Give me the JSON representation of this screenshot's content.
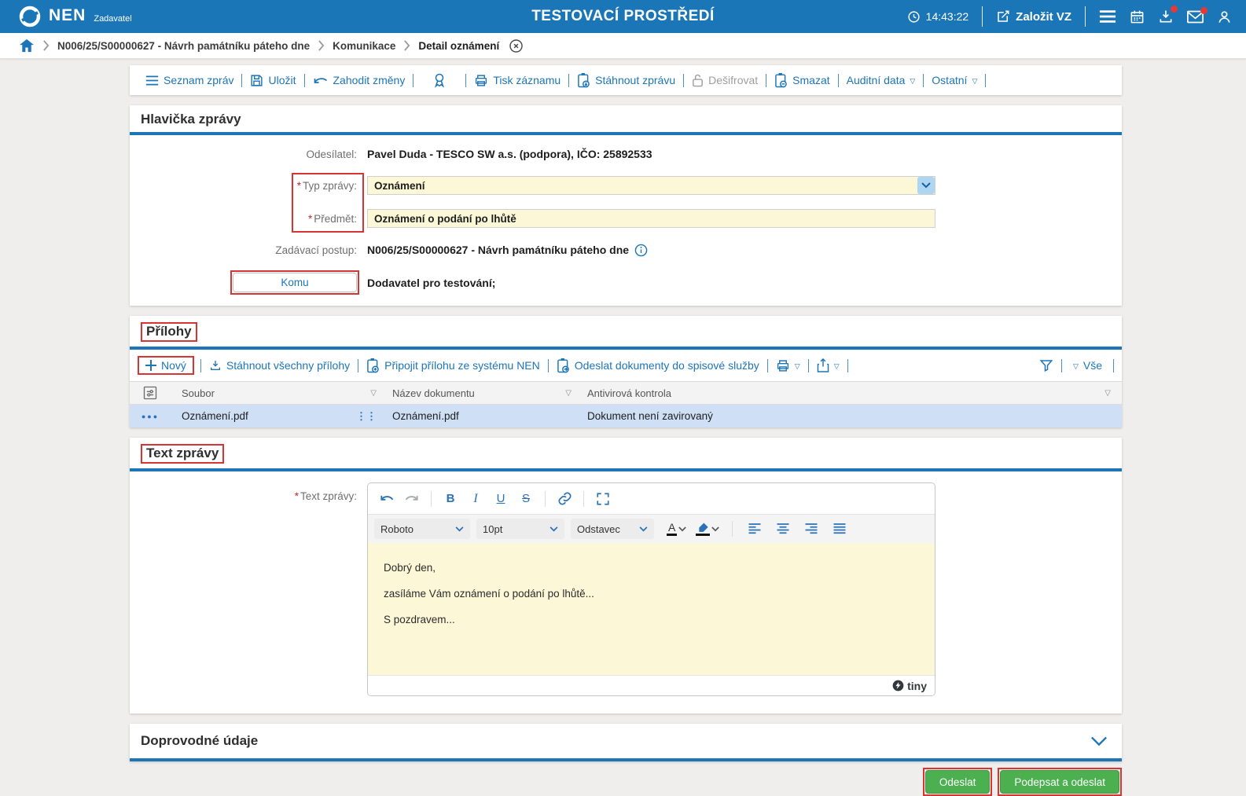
{
  "colors": {
    "header_bg": "#1b76b8",
    "link_blue": "#1b75b7",
    "field_yellow": "#fcf8d7",
    "selected_row": "#cfe0f6",
    "green_button": "#4caf50",
    "annotation_red": "#d93434",
    "notification_red": "#e53935"
  },
  "header": {
    "logo": "NEN",
    "logo_sub": "Zadavatel",
    "env_title": "TESTOVACÍ PROSTŘEDÍ",
    "time": "14:43:22",
    "create_vz": "Založit VZ"
  },
  "breadcrumb": {
    "items": [
      "N006/25/S00000627 - Návrh památníku páteho dne",
      "Komunikace",
      "Detail oznámení"
    ]
  },
  "toolbar": {
    "items": [
      {
        "label": "Seznam zpráv"
      },
      {
        "label": "Uložit"
      },
      {
        "label": "Zahodit změny"
      },
      {
        "label": "Tisk záznamu"
      },
      {
        "label": "Stáhnout zprávu"
      },
      {
        "label": "Dešifrovat"
      },
      {
        "label": "Smazat"
      },
      {
        "label": "Auditní data"
      },
      {
        "label": "Ostatní"
      }
    ]
  },
  "message_header": {
    "title": "Hlavička zprávy",
    "sender_label": "Odesílatel:",
    "sender_value": "Pavel Duda - TESCO SW a.s. (podpora), IČO: 25892533",
    "type_label": "Typ zprávy:",
    "type_value": "Oznámení",
    "subject_label": "Předmět:",
    "subject_value": "Oznámení o podání po lhůtě",
    "procedure_label": "Zadávací postup:",
    "procedure_value": "N006/25/S00000627 - Návrh památníku páteho dne",
    "to_button": "Komu",
    "to_value": "Dodavatel pro testování;"
  },
  "attachments": {
    "title": "Přílohy",
    "toolbar": {
      "new": "Nový",
      "download_all": "Stáhnout všechny přílohy",
      "attach_nen": "Připojit přílohu ze systému NEN",
      "send_filing": "Odeslat dokumenty do spisové služby",
      "all": "Vše"
    },
    "columns": [
      "Soubor",
      "Název dokumentu",
      "Antivirová kontrola"
    ],
    "rows": [
      {
        "file": "Oznámení.pdf",
        "name": "Oznámení.pdf",
        "antivirus": "Dokument není zavirovaný"
      }
    ]
  },
  "message_text": {
    "title": "Text zprávy",
    "label": "Text zprávy:",
    "editor": {
      "font": "Roboto",
      "size": "10pt",
      "block": "Odstavec",
      "bold": "B",
      "italic": "I",
      "underline": "U",
      "strike": "S",
      "color_letter": "A",
      "lines": [
        "Dobrý den,",
        "zasíláme Vám oznámení o podání po lhůtě...",
        "S pozdravem..."
      ],
      "brand": "tiny"
    }
  },
  "accompanying": {
    "title": "Doprovodné údaje"
  },
  "actions": {
    "send": "Odeslat",
    "sign_send": "Podepsat a odeslat"
  },
  "required_marker": "*",
  "icons": {
    "clock-icon": "◷",
    "edit-icon": "✎",
    "menu-icon": "≡",
    "calendar-icon": "▦",
    "download-tray-icon": "⭳",
    "mail-icon": "✉",
    "user-icon": "👤",
    "home-icon": "⌂",
    "close-circle-icon": "ⓧ",
    "list-icon": "≡",
    "save-icon": "💾",
    "undo-icon": "↶",
    "seal-icon": "🏵",
    "print-icon": "🖶",
    "doc-download-icon": "📋",
    "lock-icon": "🔒",
    "caret-down-icon": "▽",
    "plus-icon": "+",
    "funnel-icon": "⧩",
    "info-icon": "ⓘ",
    "column-settings-icon": "⚌",
    "row-menu-icon": "●●●",
    "drag-handle-icon": "⋮",
    "redo-icon": "↷",
    "link-icon": "🔗",
    "fullscreen-icon": "⛶",
    "chevron-down-icon": "⌄",
    "align-left-icon": "≣",
    "align-center-icon": "≣",
    "align-right-icon": "≣",
    "align-justify-icon": "≣",
    "highlight-pen-icon": "🖍",
    "tiny-logo-icon": "Ⓣ"
  }
}
